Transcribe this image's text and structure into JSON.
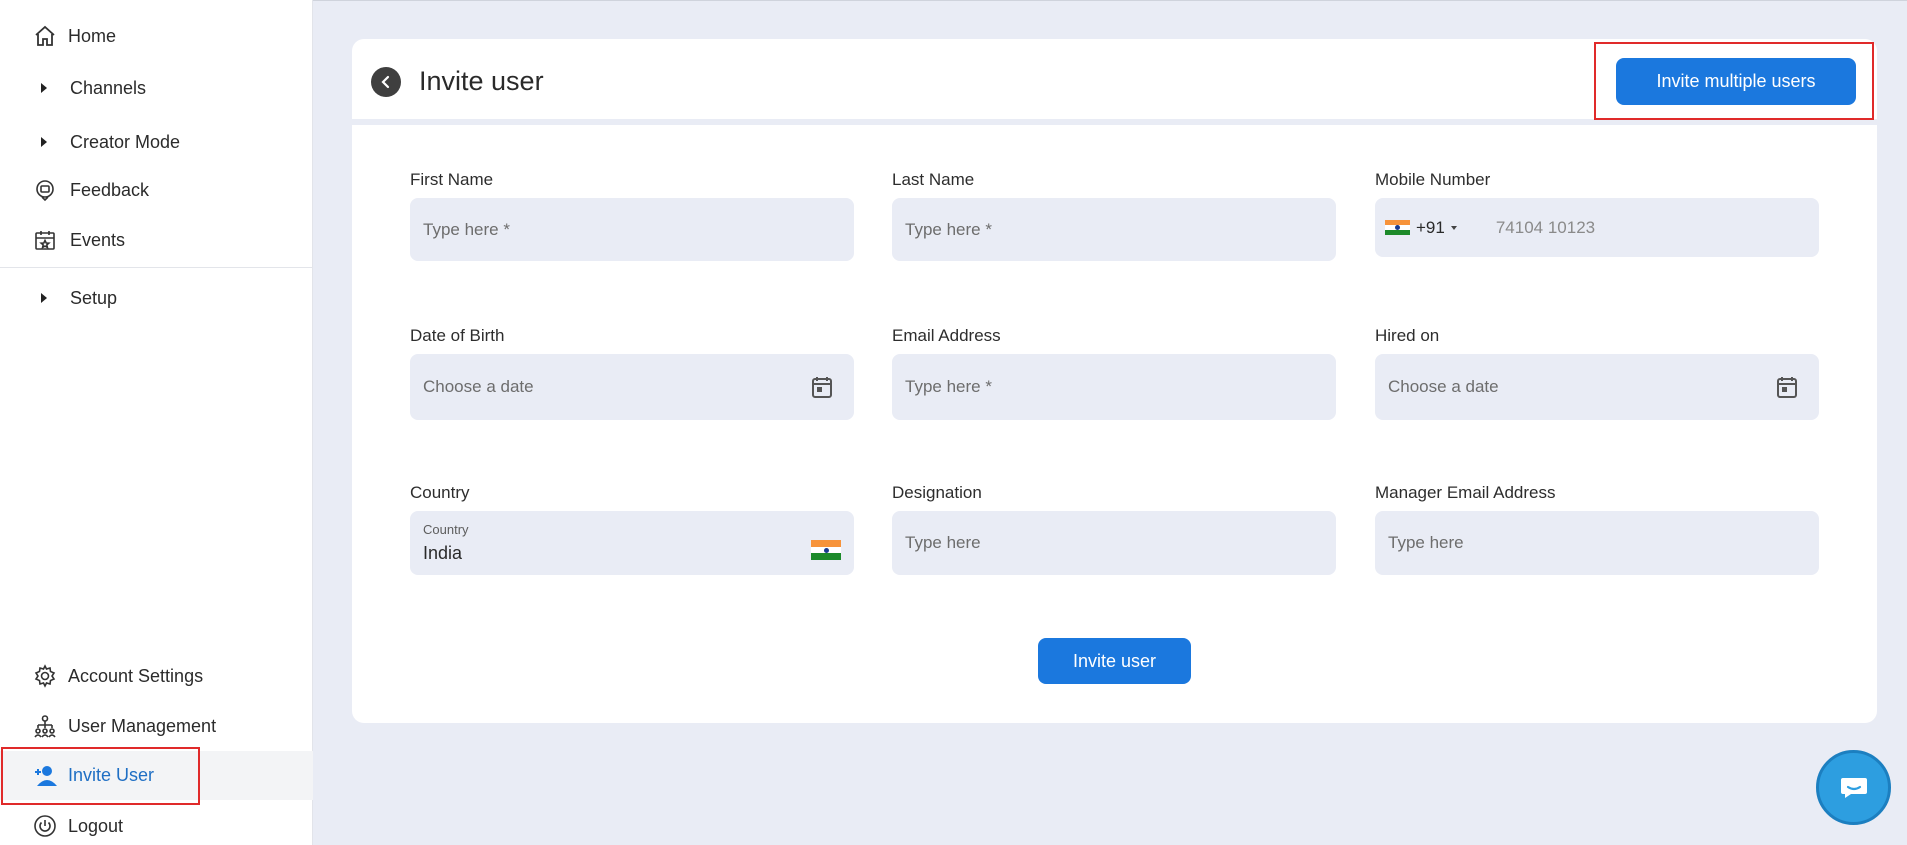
{
  "sidebar": {
    "items": [
      {
        "label": "Home",
        "icon": "home-icon"
      },
      {
        "label": "Channels",
        "icon": "caret-right-icon"
      },
      {
        "label": "Creator Mode",
        "icon": "caret-right-icon"
      },
      {
        "label": "Feedback",
        "icon": "feedback-icon"
      },
      {
        "label": "Events",
        "icon": "calendar-star-icon"
      },
      {
        "label": "Setup",
        "icon": "caret-right-icon"
      }
    ],
    "bottom_items": [
      {
        "label": "Account Settings",
        "icon": "gear-icon"
      },
      {
        "label": "User Management",
        "icon": "org-chart-icon"
      },
      {
        "label": "Invite User",
        "icon": "add-user-icon",
        "active": true
      },
      {
        "label": "Logout",
        "icon": "power-icon"
      }
    ]
  },
  "header": {
    "title": "Invite user",
    "invite_multiple_label": "Invite multiple users"
  },
  "form": {
    "first_name": {
      "label": "First Name",
      "placeholder": "Type here *"
    },
    "last_name": {
      "label": "Last Name",
      "placeholder": "Type here *"
    },
    "mobile": {
      "label": "Mobile Number",
      "code": "+91",
      "placeholder": "74104 10123"
    },
    "dob": {
      "label": "Date of Birth",
      "placeholder": "Choose a date"
    },
    "email": {
      "label": "Email Address",
      "placeholder": "Type here *"
    },
    "hired_on": {
      "label": "Hired on",
      "placeholder": "Choose a date"
    },
    "country": {
      "label": "Country",
      "inner_label": "Country",
      "value": "India"
    },
    "designation": {
      "label": "Designation",
      "placeholder": "Type here"
    },
    "manager_email": {
      "label": "Manager Email Address",
      "placeholder": "Type here"
    },
    "submit_label": "Invite user"
  },
  "colors": {
    "accent": "#1b78de",
    "highlight": "#e02a2a",
    "background": "#e9ecf5"
  }
}
